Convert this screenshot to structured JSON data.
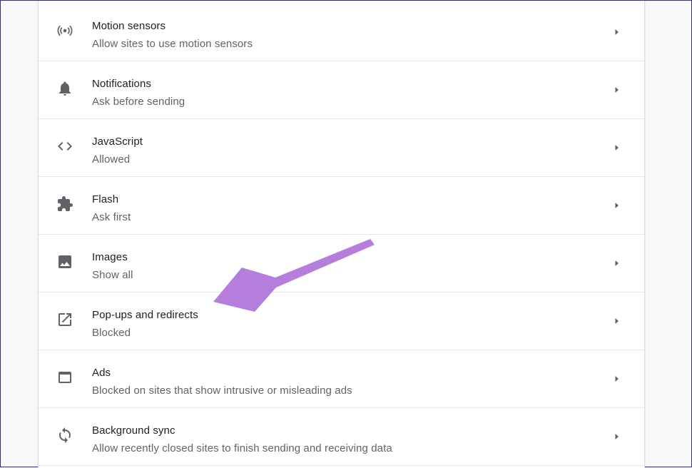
{
  "settings": {
    "items": [
      {
        "title": "Motion sensors",
        "subtitle": "Allow sites to use motion sensors",
        "icon": "motion-sensor-icon"
      },
      {
        "title": "Notifications",
        "subtitle": "Ask before sending",
        "icon": "bell-icon"
      },
      {
        "title": "JavaScript",
        "subtitle": "Allowed",
        "icon": "code-icon"
      },
      {
        "title": "Flash",
        "subtitle": "Ask first",
        "icon": "puzzle-piece-icon"
      },
      {
        "title": "Images",
        "subtitle": "Show all",
        "icon": "image-icon"
      },
      {
        "title": "Pop-ups and redirects",
        "subtitle": "Blocked",
        "icon": "external-link-icon"
      },
      {
        "title": "Ads",
        "subtitle": "Blocked on sites that show intrusive or misleading ads",
        "icon": "browser-window-icon"
      },
      {
        "title": "Background sync",
        "subtitle": "Allow recently closed sites to finish sending and receiving data",
        "icon": "sync-icon"
      }
    ]
  },
  "colors": {
    "background": "#f8f9fa",
    "panel": "#ffffff",
    "title_text": "#202124",
    "subtitle_text": "#5f6368",
    "icon": "#5f6368",
    "divider": "#e6e6e6",
    "annotation_arrow": "#b57edc"
  }
}
